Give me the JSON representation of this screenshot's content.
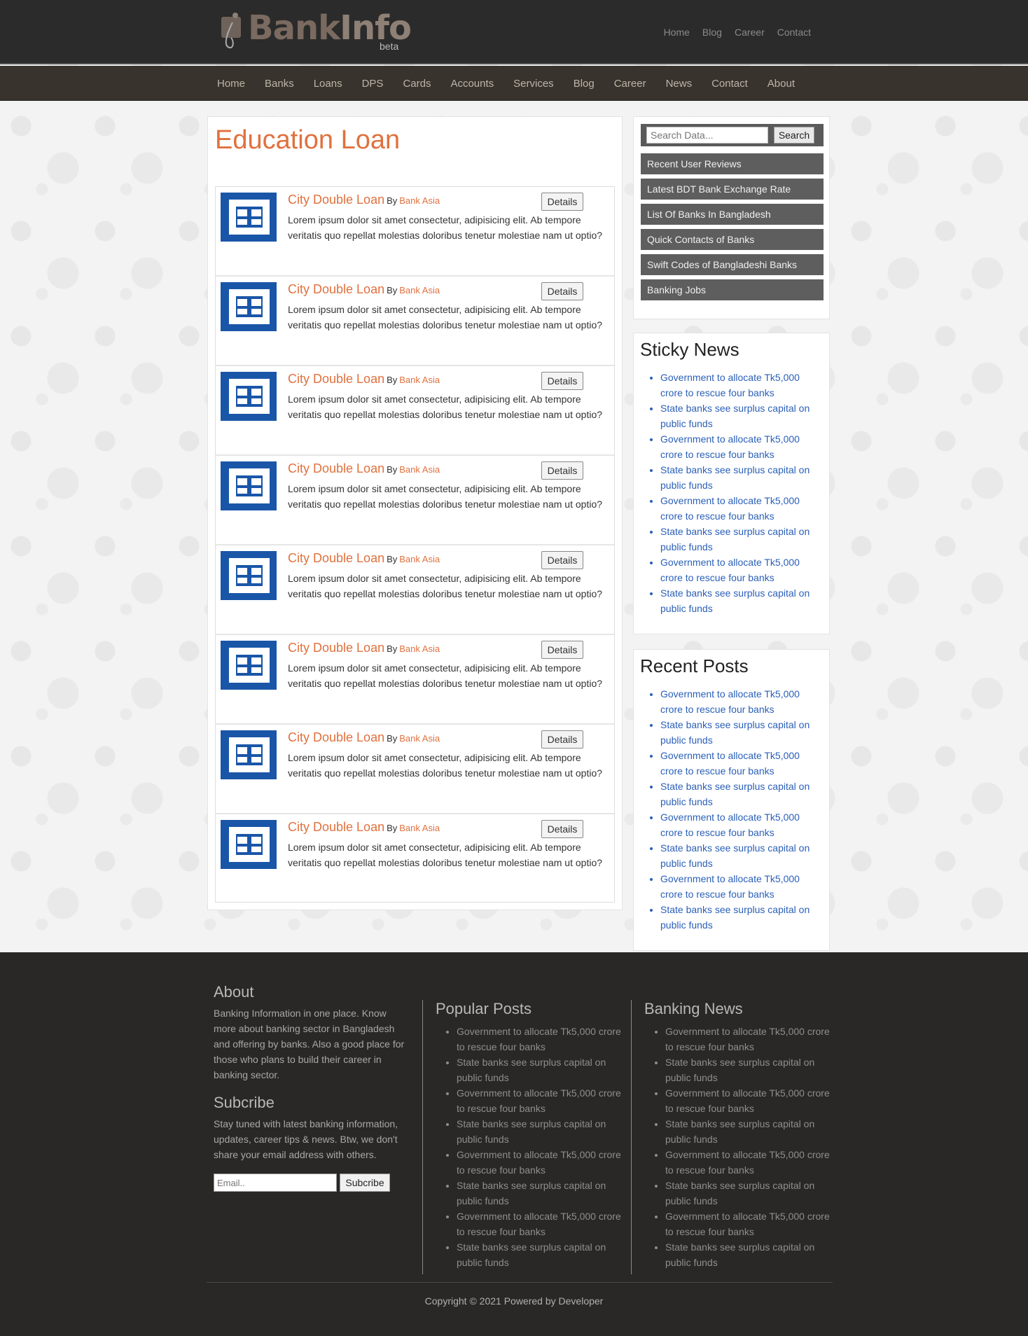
{
  "header": {
    "logo": {
      "part1": "Bank",
      "part2": "Info",
      "beta": "beta"
    },
    "top_links": [
      "Home",
      "Blog",
      "Career",
      "Contact"
    ]
  },
  "nav": {
    "items": [
      "Home",
      "Banks",
      "Loans",
      "DPS",
      "Cards",
      "Accounts",
      "Services",
      "Blog",
      "Career",
      "News",
      "Contact",
      "About"
    ]
  },
  "main": {
    "title": "Education Loan",
    "details_label": "Details",
    "by_label": "By",
    "loans": [
      {
        "title": "City Double Loan",
        "bank": "Bank Asia",
        "description": "Lorem ipsum dolor sit amet consectetur, adipisicing elit. Ab tempore veritatis quo repellat molestias doloribus tenetur molestiae nam ut optio?"
      },
      {
        "title": "City Double Loan",
        "bank": "Bank Asia",
        "description": "Lorem ipsum dolor sit amet consectetur, adipisicing elit. Ab tempore veritatis quo repellat molestias doloribus tenetur molestiae nam ut optio?"
      },
      {
        "title": "City Double Loan",
        "bank": "Bank Asia",
        "description": "Lorem ipsum dolor sit amet consectetur, adipisicing elit. Ab tempore veritatis quo repellat molestias doloribus tenetur molestiae nam ut optio?"
      },
      {
        "title": "City Double Loan",
        "bank": "Bank Asia",
        "description": "Lorem ipsum dolor sit amet consectetur, adipisicing elit. Ab tempore veritatis quo repellat molestias doloribus tenetur molestiae nam ut optio?"
      },
      {
        "title": "City Double Loan",
        "bank": "Bank Asia",
        "description": "Lorem ipsum dolor sit amet consectetur, adipisicing elit. Ab tempore veritatis quo repellat molestias doloribus tenetur molestiae nam ut optio?"
      },
      {
        "title": "City Double Loan",
        "bank": "Bank Asia",
        "description": "Lorem ipsum dolor sit amet consectetur, adipisicing elit. Ab tempore veritatis quo repellat molestias doloribus tenetur molestiae nam ut optio?"
      },
      {
        "title": "City Double Loan",
        "bank": "Bank Asia",
        "description": "Lorem ipsum dolor sit amet consectetur, adipisicing elit. Ab tempore veritatis quo repellat molestias doloribus tenetur molestiae nam ut optio?"
      },
      {
        "title": "City Double Loan",
        "bank": "Bank Asia",
        "description": "Lorem ipsum dolor sit amet consectetur, adipisicing elit. Ab tempore veritatis quo repellat molestias doloribus tenetur molestiae nam ut optio?"
      }
    ]
  },
  "sidebar": {
    "search": {
      "placeholder": "Search Data...",
      "button": "Search"
    },
    "links": [
      "Recent User Reviews",
      "Latest BDT Bank Exchange Rate",
      "List Of Banks In Bangladesh",
      "Quick Contacts of Banks",
      "Swift Codes of Bangladeshi Banks",
      "Banking Jobs"
    ],
    "sticky_news": {
      "title": "Sticky News",
      "items": [
        "Government to allocate Tk5,000 crore to rescue four banks",
        "State banks see surplus capital on public funds",
        "Government to allocate Tk5,000 crore to rescue four banks",
        "State banks see surplus capital on public funds",
        "Government to allocate Tk5,000 crore to rescue four banks",
        "State banks see surplus capital on public funds",
        "Government to allocate Tk5,000 crore to rescue four banks",
        "State banks see surplus capital on public funds"
      ]
    },
    "recent_posts": {
      "title": "Recent Posts",
      "items": [
        "Government to allocate Tk5,000 crore to rescue four banks",
        "State banks see surplus capital on public funds",
        "Government to allocate Tk5,000 crore to rescue four banks",
        "State banks see surplus capital on public funds",
        "Government to allocate Tk5,000 crore to rescue four banks",
        "State banks see surplus capital on public funds",
        "Government to allocate Tk5,000 crore to rescue four banks",
        "State banks see surplus capital on public funds"
      ]
    }
  },
  "footer": {
    "about": {
      "title": "About",
      "text": "Banking Information in one place. Know more about banking sector in Bangladesh and offering by banks. Also a good place for those who plans to build their career in banking sector."
    },
    "subscribe": {
      "title": "Subcribe",
      "text": "Stay tuned with latest banking information, updates, career tips & news. Btw, we don't share your email address with others.",
      "placeholder": "Email..",
      "button": "Subcribe"
    },
    "popular_posts": {
      "title": "Popular Posts",
      "items": [
        "Government to allocate Tk5,000 crore to rescue four banks",
        "State banks see surplus capital on public funds",
        "Government to allocate Tk5,000 crore to rescue four banks",
        "State banks see surplus capital on public funds",
        "Government to allocate Tk5,000 crore to rescue four banks",
        "State banks see surplus capital on public funds",
        "Government to allocate Tk5,000 crore to rescue four banks",
        "State banks see surplus capital on public funds"
      ]
    },
    "banking_news": {
      "title": "Banking News",
      "items": [
        "Government to allocate Tk5,000 crore to rescue four banks",
        "State banks see surplus capital on public funds",
        "Government to allocate Tk5,000 crore to rescue four banks",
        "State banks see surplus capital on public funds",
        "Government to allocate Tk5,000 crore to rescue four banks",
        "State banks see surplus capital on public funds",
        "Government to allocate Tk5,000 crore to rescue four banks",
        "State banks see surplus capital on public funds"
      ]
    },
    "copyright": "Copyright © 2021 Powered by Developer"
  },
  "colors": {
    "accent": "#e0713e",
    "link": "#2a5fb8",
    "bank_logo": "#1a56a8",
    "header_bg": "#2b2b2b",
    "nav_bg": "#38332c",
    "footer_bg": "#2a2826"
  }
}
